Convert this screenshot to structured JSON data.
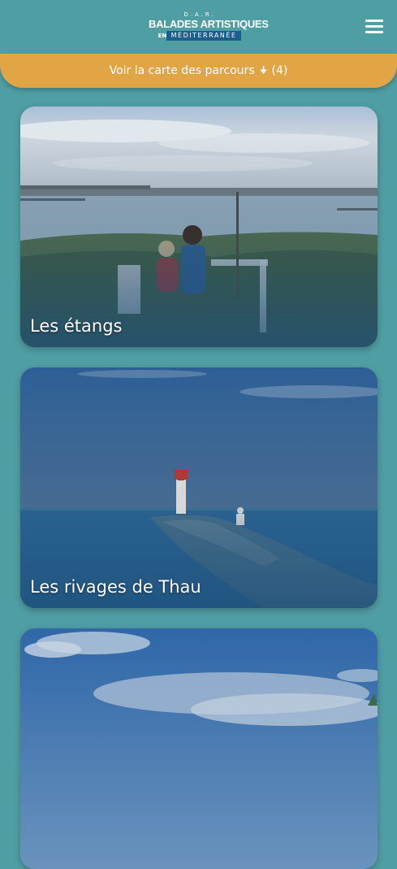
{
  "header": {
    "logo_top": "D.A.R.",
    "logo_main": "BALADES ARTISTIQUES",
    "logo_prefix": "EN",
    "logo_sub": "MÉDITERRANÉE"
  },
  "map_bar": {
    "label": "Voir la carte des parcours",
    "count": "(4)"
  },
  "cards": [
    {
      "title": "Les étangs"
    },
    {
      "title": "Les rivages de Thau"
    },
    {
      "title": ""
    }
  ],
  "colors": {
    "background": "#4f9ea3",
    "accent": "#e2a546",
    "logo_band": "#1c5f8c"
  },
  "icons": {
    "menu": "hamburger-menu-icon",
    "arrow": "arrow-down-icon"
  }
}
